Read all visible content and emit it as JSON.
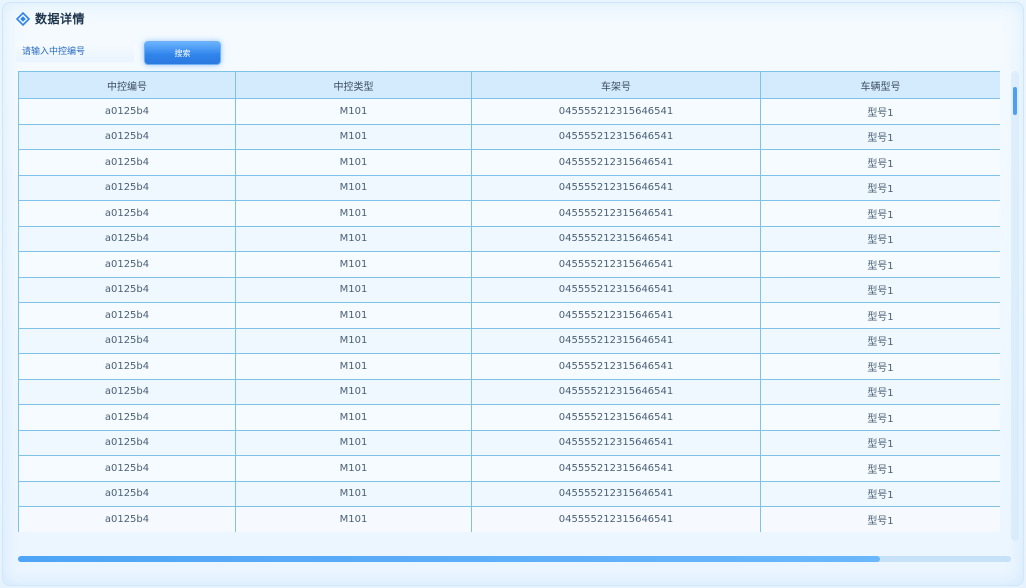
{
  "title": "数据详情",
  "search": {
    "placeholder": "请输入中控编号",
    "value": "",
    "button_label": "搜索"
  },
  "table": {
    "headers": [
      "中控编号",
      "中控类型",
      "车架号",
      "车辆型号"
    ],
    "rows": [
      [
        "a0125b4",
        "M101",
        "045555212315646541",
        "型号1"
      ],
      [
        "a0125b4",
        "M101",
        "045555212315646541",
        "型号1"
      ],
      [
        "a0125b4",
        "M101",
        "045555212315646541",
        "型号1"
      ],
      [
        "a0125b4",
        "M101",
        "045555212315646541",
        "型号1"
      ],
      [
        "a0125b4",
        "M101",
        "045555212315646541",
        "型号1"
      ],
      [
        "a0125b4",
        "M101",
        "045555212315646541",
        "型号1"
      ],
      [
        "a0125b4",
        "M101",
        "045555212315646541",
        "型号1"
      ],
      [
        "a0125b4",
        "M101",
        "045555212315646541",
        "型号1"
      ],
      [
        "a0125b4",
        "M101",
        "045555212315646541",
        "型号1"
      ],
      [
        "a0125b4",
        "M101",
        "045555212315646541",
        "型号1"
      ],
      [
        "a0125b4",
        "M101",
        "045555212315646541",
        "型号1"
      ],
      [
        "a0125b4",
        "M101",
        "045555212315646541",
        "型号1"
      ],
      [
        "a0125b4",
        "M101",
        "045555212315646541",
        "型号1"
      ],
      [
        "a0125b4",
        "M101",
        "045555212315646541",
        "型号1"
      ],
      [
        "a0125b4",
        "M101",
        "045555212315646541",
        "型号1"
      ],
      [
        "a0125b4",
        "M101",
        "045555212315646541",
        "型号1"
      ],
      [
        "a0125b4",
        "M101",
        "045555212315646541",
        "型号1"
      ]
    ]
  },
  "colors": {
    "accent": "#2f83ea",
    "grid": "#7ec2e8",
    "header_bg": "#cde8fc"
  },
  "icons": {
    "title": "diamond-icon"
  }
}
